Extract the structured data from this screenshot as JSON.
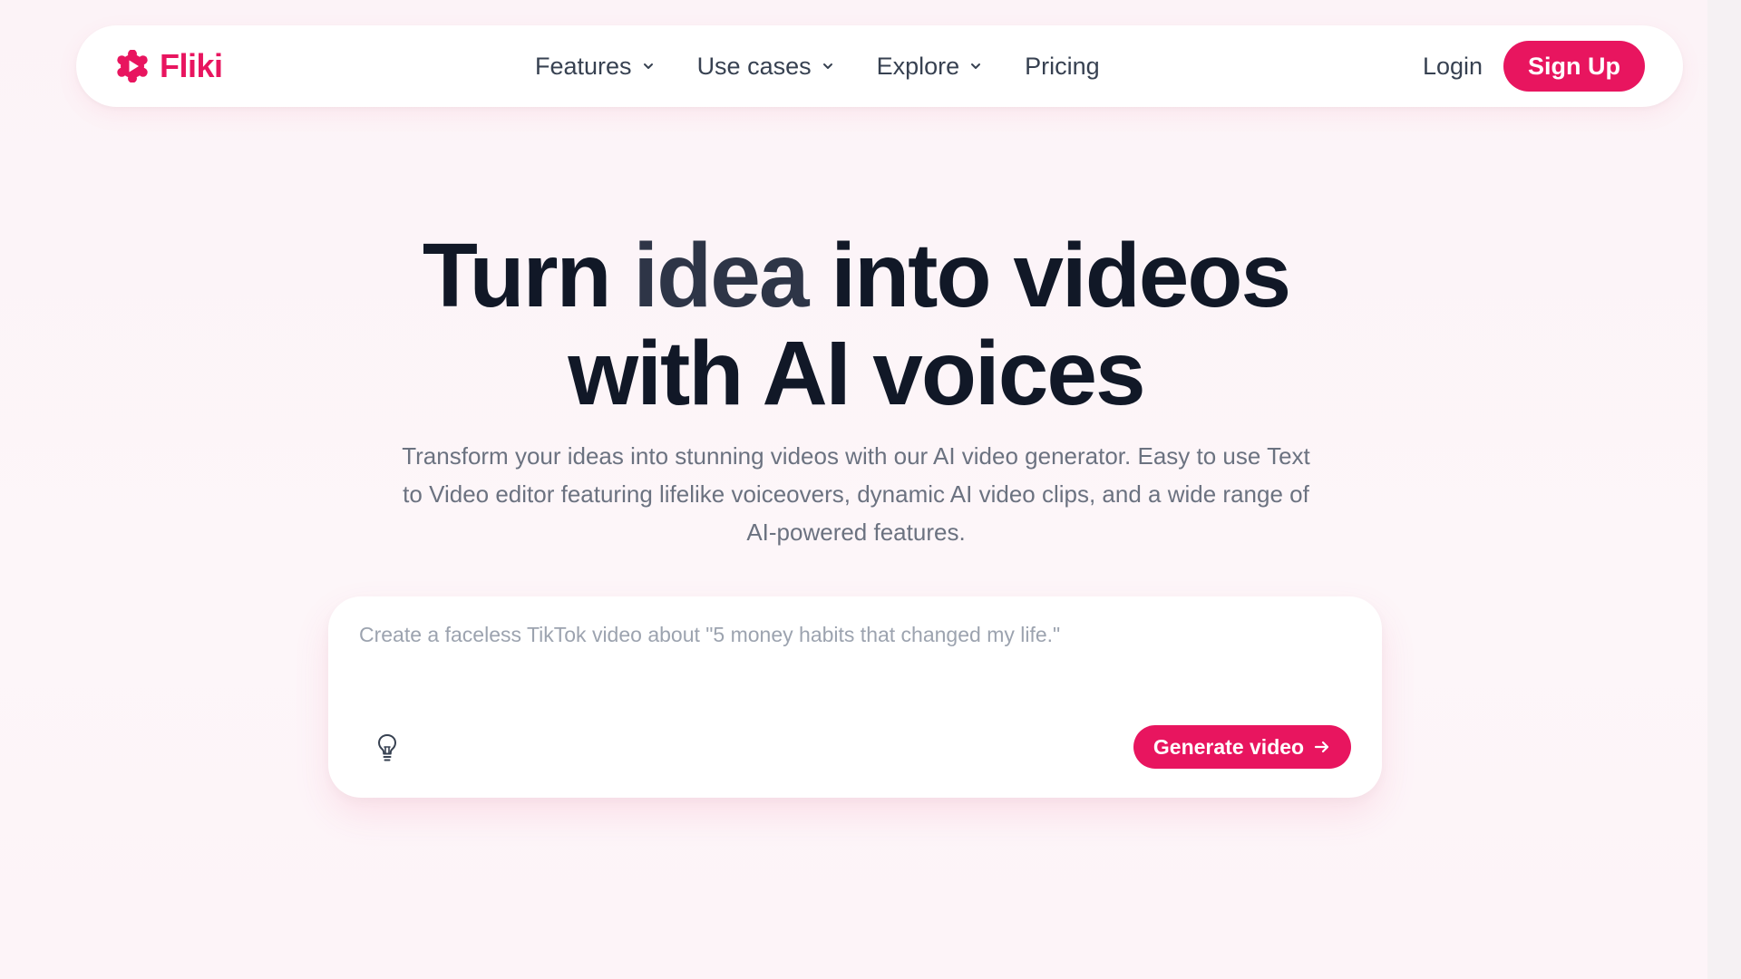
{
  "brand": {
    "name": "Fliki",
    "color": "#e8155f"
  },
  "nav": {
    "items": [
      {
        "label": "Features",
        "has_dropdown": true
      },
      {
        "label": "Use cases",
        "has_dropdown": true
      },
      {
        "label": "Explore",
        "has_dropdown": true
      },
      {
        "label": "Pricing",
        "has_dropdown": false
      }
    ],
    "login_label": "Login",
    "signup_label": "Sign Up"
  },
  "hero": {
    "title_part1": "Turn ",
    "title_accent": "idea",
    "title_part2": " into videos",
    "title_line2": "with AI voices",
    "subtitle": "Transform your ideas into stunning videos with our AI video generator. Easy to use Text to Video editor featuring lifelike voiceovers, dynamic AI video clips, and a wide range of AI-powered features."
  },
  "prompt": {
    "placeholder": "Create a faceless TikTok video about \"5 money habits that changed my life.\"",
    "value": "",
    "generate_label": "Generate video",
    "icons": {
      "idea": "lightbulb-icon",
      "submit": "arrow-right-icon"
    }
  },
  "colors": {
    "accent": "#e8155f",
    "background": "#fdf4f8",
    "text_dark": "#111827",
    "text_muted": "#6b7280"
  }
}
